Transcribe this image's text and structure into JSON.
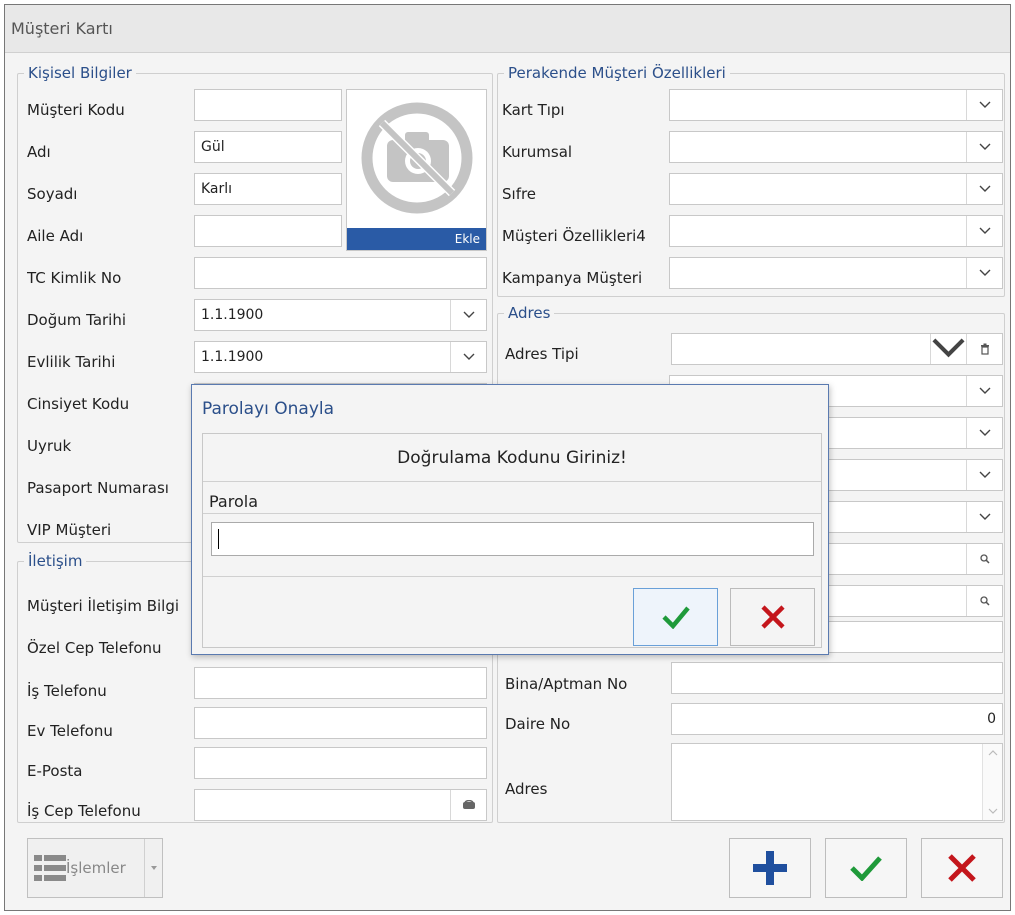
{
  "window": {
    "title": "Müşteri Kartı"
  },
  "personal": {
    "section_title": "Kişisel Bilgiler",
    "musteri_kodu": {
      "label": "Müşteri Kodu",
      "value": ""
    },
    "adi": {
      "label": "Adı",
      "value": "Gül"
    },
    "soyadi": {
      "label": "Soyadı",
      "value": "Karlı"
    },
    "aile_adi": {
      "label": "Aile Adı",
      "value": ""
    },
    "tc_kimlik_no": {
      "label": "TC Kimlik No",
      "value": ""
    },
    "dogum_tarihi": {
      "label": "Doğum Tarihi",
      "value": "1.1.1900"
    },
    "evlilik_tarihi": {
      "label": "Evlilik Tarihi",
      "value": "1.1.1900"
    },
    "cinsiyet_kodu": {
      "label": "Cinsiyet Kodu"
    },
    "uyruk": {
      "label": "Uyruk"
    },
    "pasaport_numarasi": {
      "label": "Pasaport Numarası"
    },
    "vip_musteri": {
      "label": "VIP Müşteri"
    },
    "photo_add_label": "Ekle"
  },
  "contact": {
    "section_title": "İletişim",
    "iletisim_bilgi": {
      "label": "Müşteri İletişim Bilgi"
    },
    "ozel_cep": {
      "label": "Özel Cep Telefonu"
    },
    "is_telefonu": {
      "label": "İş Telefonu",
      "value": ""
    },
    "ev_telefonu": {
      "label": "Ev Telefonu",
      "value": ""
    },
    "eposta": {
      "label": "E-Posta",
      "value": ""
    },
    "is_cep": {
      "label": "İş Cep Telefonu",
      "value": ""
    }
  },
  "retail": {
    "section_title": "Perakende Müşteri Özellikleri",
    "kart_tipi": {
      "label": "Kart Tıpı",
      "value": ""
    },
    "kurumsal": {
      "label": "Kurumsal",
      "value": ""
    },
    "sifre": {
      "label": "Sıfre",
      "value": ""
    },
    "ozellik4": {
      "label": "Müşteri Özellikleri4",
      "value": ""
    },
    "kampanya": {
      "label": "Kampanya Müşteri",
      "value": ""
    }
  },
  "address": {
    "section_title": "Adres",
    "adres_tipi": {
      "label": "Adres Tipi",
      "value": ""
    },
    "bina_no": {
      "label": "Bina/Aptman No",
      "value": ""
    },
    "daire_no": {
      "label": "Daire No",
      "value": "0"
    },
    "adres": {
      "label": "Adres",
      "value": ""
    }
  },
  "bottom": {
    "islemler_label": "İşlemler"
  },
  "dialog": {
    "title": "Parolayı Onayla",
    "header": "Doğrulama Kodunu Giriniz!",
    "password_label": "Parola",
    "password_value": ""
  },
  "colors": {
    "accent": "#2a5ba6",
    "confirm": "#1f9a3a",
    "cancel": "#c4161c"
  }
}
